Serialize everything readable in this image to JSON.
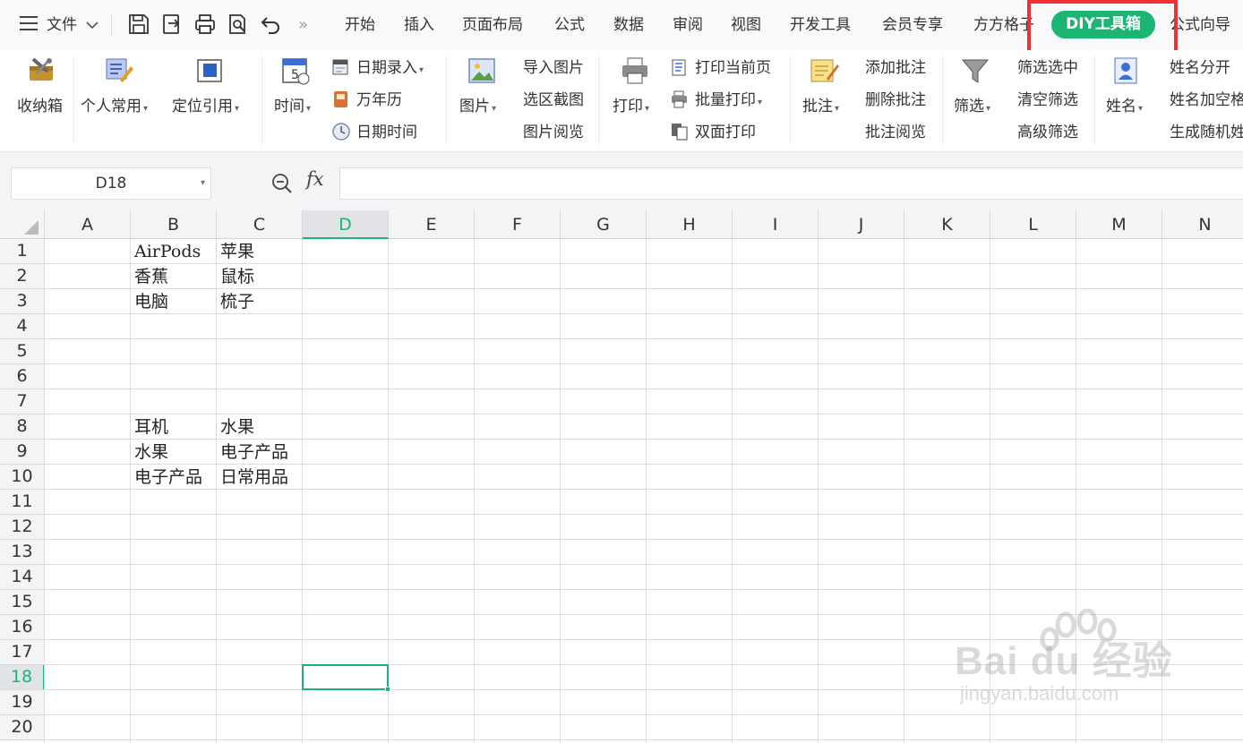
{
  "menubar": {
    "file_label": "文件",
    "more_glyph": "»",
    "tabs": [
      "开始",
      "插入",
      "页面布局",
      "公式",
      "数据",
      "审阅",
      "视图",
      "开发工具",
      "会员专享",
      "方方格子",
      "DIY工具箱",
      "公式向导"
    ],
    "active_tab": "DIY工具箱"
  },
  "ribbon": {
    "storage_box": "收纳箱",
    "personal_common": "个人常用",
    "locate_ref": "定位引用",
    "time": "时间",
    "date_entry": "日期录入",
    "perpetual_calendar": "万年历",
    "date_time": "日期时间",
    "picture": "图片",
    "import_picture": "导入图片",
    "region_screenshot": "选区截图",
    "picture_view": "图片阅览",
    "print": "打印",
    "print_current_page": "打印当前页",
    "batch_print": "批量打印",
    "duplex_print": "双面打印",
    "comment": "批注",
    "add_comment": "添加批注",
    "delete_comment": "删除批注",
    "comment_view": "批注阅览",
    "filter": "筛选",
    "filter_selected": "筛选选中",
    "clear_filter": "清空筛选",
    "advanced_filter": "高级筛选",
    "name": "姓名",
    "split_name": "姓名分开",
    "name_add_space": "姓名加空格",
    "random_name": "生成随机姓"
  },
  "formula_bar": {
    "cell_ref": "D18",
    "fx_label": "fx",
    "value": ""
  },
  "sheet": {
    "columns": [
      "A",
      "B",
      "C",
      "D",
      "E",
      "F",
      "G",
      "H",
      "I",
      "J",
      "K",
      "L",
      "M",
      "N"
    ],
    "rows": [
      "1",
      "2",
      "3",
      "4",
      "5",
      "6",
      "7",
      "8",
      "9",
      "10",
      "11",
      "12",
      "13",
      "14",
      "15",
      "16",
      "17",
      "18",
      "19",
      "20"
    ],
    "selected_column": "D",
    "selected_row": "18",
    "cells": {
      "B1": "AirPods",
      "C1": "苹果",
      "B2": "香蕉",
      "C2": "鼠标",
      "B3": "电脑",
      "C3": "梳子",
      "B8": "耳机",
      "C8": "水果",
      "B9": "水果",
      "C9": "电子产品",
      "B10": "电子产品",
      "C10": "日常用品"
    }
  },
  "watermark": {
    "brand": "Bai du 经验",
    "url": "jingyan.baidu.com"
  },
  "colors": {
    "accent_green": "#1cb472",
    "highlight_red": "#ee3030"
  }
}
